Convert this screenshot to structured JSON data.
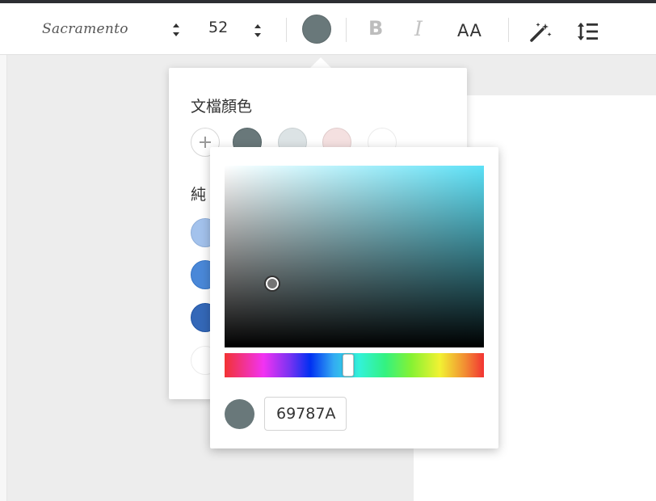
{
  "toolbar": {
    "font_name": "Sacramento",
    "font_size": "52",
    "current_color": "#69787a",
    "bold_label": "B",
    "italic_label": "I",
    "case_label": "AA",
    "magic_icon": "magic-wand-icon",
    "spacing_icon": "line-spacing-icon"
  },
  "color_popup": {
    "document_colors_title": "文檔顏色",
    "add_icon": "plus-icon",
    "document_colors": [
      "#69787a",
      "#dce3e5",
      "#f4e0e0",
      "#ffffff"
    ],
    "solid_colors_title": "純",
    "solid_colors": [
      "#a3c2ec",
      "#4a88d8",
      "#3468b8",
      "#ffffff"
    ]
  },
  "picker": {
    "hue_color": "#5ce1f7",
    "hex_value": "69787A",
    "preview_color": "#69787a"
  }
}
